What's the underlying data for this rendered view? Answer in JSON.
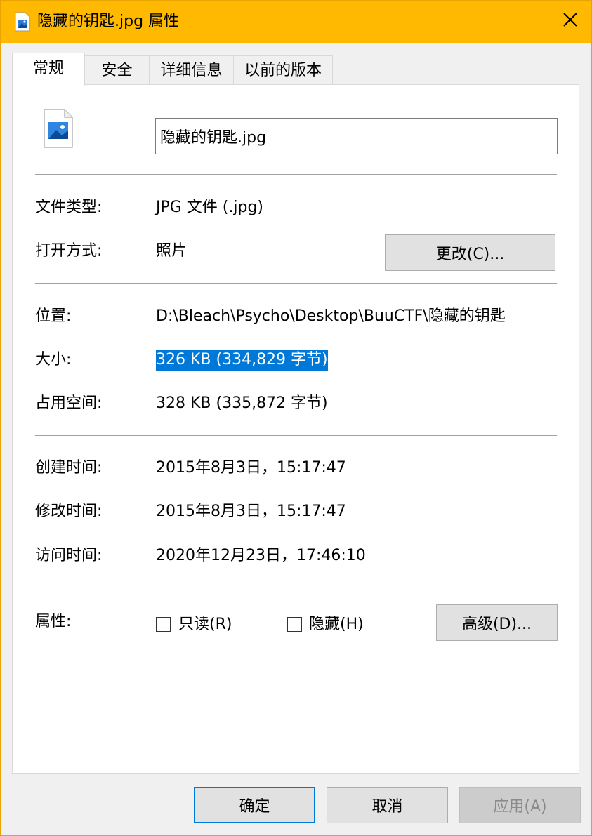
{
  "window": {
    "title": "隐藏的钥匙.jpg 属性"
  },
  "tabs": [
    {
      "label": "常规",
      "active": true
    },
    {
      "label": "安全",
      "active": false
    },
    {
      "label": "详细信息",
      "active": false
    },
    {
      "label": "以前的版本",
      "active": false
    }
  ],
  "general": {
    "file_name": "隐藏的钥匙.jpg",
    "type_label": "文件类型:",
    "type_value": "JPG 文件 (.jpg)",
    "open_with_label": "打开方式:",
    "open_with_value": "照片",
    "change_button": "更改(C)...",
    "location_label": "位置:",
    "location_value": "D:\\Bleach\\Psycho\\Desktop\\BuuCTF\\隐藏的钥匙",
    "size_label": "大小:",
    "size_value": "326 KB (334,829 字节)",
    "disk_size_label": "占用空间:",
    "disk_size_value": "328 KB (335,872 字节)",
    "created_label": "创建时间:",
    "created_value": "2015年8月3日，15:17:47",
    "modified_label": "修改时间:",
    "modified_value": "2015年8月3日，15:17:47",
    "accessed_label": "访问时间:",
    "accessed_value": "2020年12月23日，17:46:10",
    "attributes_label": "属性:",
    "readonly_label": "只读(R)",
    "readonly_checked": false,
    "hidden_label": "隐藏(H)",
    "hidden_checked": false,
    "advanced_button": "高级(D)..."
  },
  "footer": {
    "ok_button": "确定",
    "cancel_button": "取消",
    "apply_button": "应用(A)"
  },
  "colors": {
    "titlebar": "#ffb900",
    "selection": "#0078d7",
    "default_button_border": "#0078d7"
  },
  "icons": {
    "title": "image-file-icon",
    "close": "close-icon",
    "file": "image-file-icon"
  }
}
